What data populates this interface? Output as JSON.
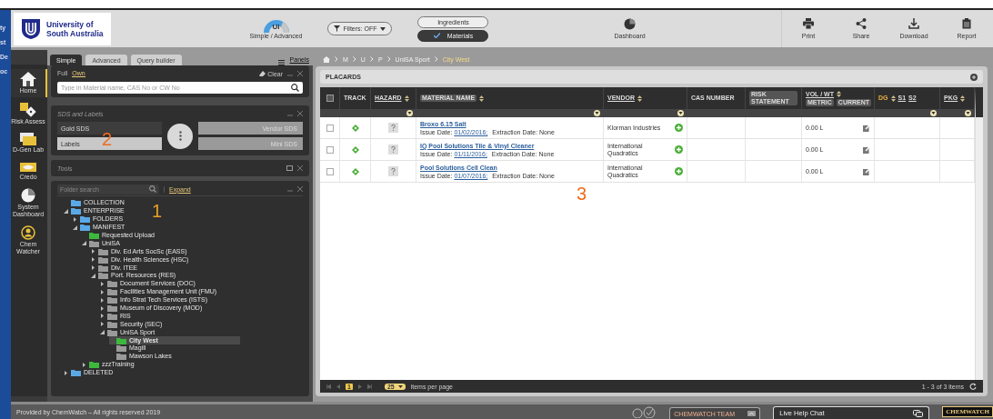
{
  "backdrop_fragments": [
    "ty",
    "st",
    "De",
    "oc"
  ],
  "header": {
    "logo_text": [
      "University of",
      "South Australia"
    ],
    "ui_toggle": {
      "label": "UI",
      "caption": "Simple / Advanced"
    },
    "filters": {
      "label": "Filters: OFF"
    },
    "mode_toggles": [
      {
        "label": "Ingredients",
        "selected": false
      },
      {
        "label": "Materials",
        "selected": true
      }
    ],
    "dashboard": "Dashboard",
    "actions": [
      {
        "kind": "print",
        "label": "Print"
      },
      {
        "kind": "share",
        "label": "Share"
      },
      {
        "kind": "download",
        "label": "Download"
      },
      {
        "kind": "report",
        "label": "Report"
      }
    ]
  },
  "sidebar": [
    {
      "kind": "home",
      "label": "Home",
      "selected": true
    },
    {
      "kind": "risk",
      "label": "Risk Assess",
      "selected": false
    },
    {
      "kind": "dgen",
      "label": "D-Gen Lab",
      "selected": false
    },
    {
      "kind": "credo",
      "label": "Credo",
      "selected": false
    },
    {
      "kind": "dashboard",
      "label": "System Dashboard",
      "selected": false
    },
    {
      "kind": "watcher",
      "label": "Chem Watcher",
      "selected": false
    }
  ],
  "left_tabs": [
    {
      "label": "Simple",
      "selected": true
    },
    {
      "label": "Advanced",
      "selected": false
    },
    {
      "label": "Query builder",
      "selected": false
    }
  ],
  "panels_link": "Panels",
  "search_panel": {
    "scopes": [
      {
        "label": "Full",
        "selected": false
      },
      {
        "label": "Own",
        "selected": true
      }
    ],
    "clear": "Clear",
    "placeholder": "Type in Material name, CAS No or CW No"
  },
  "sds_panel": {
    "title": "SDS and Labels",
    "options": [
      {
        "label": "Gold SDS",
        "selected": false
      },
      {
        "label": "Vendor SDS",
        "selected": false
      },
      {
        "label": "Labels",
        "selected": true
      },
      {
        "label": "Mini SDS",
        "selected": false
      }
    ]
  },
  "tools_panel": {
    "title": "Tools"
  },
  "folder_panel": {
    "placeholder": "Folder search",
    "expand": "Expand",
    "tree": [
      {
        "label": "COLLECTION",
        "color": "#5aa9e6",
        "selected": false
      },
      {
        "label": "ENTERPRISE",
        "color": "#5aa9e6",
        "expanded": true,
        "selected": false,
        "children": [
          {
            "label": "FOLDERS",
            "color": "#5aa9e6",
            "expanded": false,
            "selected": false
          },
          {
            "label": "MANIFEST",
            "color": "#5aa9e6",
            "expanded": true,
            "selected": false,
            "children": [
              {
                "label": "Requested Upload",
                "color": "#3db83d",
                "selected": false
              },
              {
                "label": "UniSA",
                "color": "#9a9a9a",
                "expanded": true,
                "selected": false,
                "children": [
                  {
                    "label": "Div. Ed Arts SocSc (EASS)",
                    "color": "#9a9a9a",
                    "expanded": false,
                    "selected": false
                  },
                  {
                    "label": "Div. Health Sciences (HSC)",
                    "color": "#9a9a9a",
                    "expanded": false,
                    "selected": false
                  },
                  {
                    "label": "Div. ITEE",
                    "color": "#9a9a9a",
                    "expanded": false,
                    "selected": false
                  },
                  {
                    "label": "Port. Resources (RES)",
                    "color": "#9a9a9a",
                    "expanded": true,
                    "selected": false,
                    "children": [
                      {
                        "label": "Document Services (DOC)",
                        "color": "#9a9a9a",
                        "expanded": false,
                        "selected": false
                      },
                      {
                        "label": "Facilities Management Unit (FMU)",
                        "color": "#9a9a9a",
                        "expanded": false,
                        "selected": false
                      },
                      {
                        "label": "Info Strat Tech Services (ISTS)",
                        "color": "#9a9a9a",
                        "expanded": false,
                        "selected": false
                      },
                      {
                        "label": "Museum of Discovery (MOD)",
                        "color": "#9a9a9a",
                        "expanded": false,
                        "selected": false
                      },
                      {
                        "label": "RIS",
                        "color": "#9a9a9a",
                        "expanded": false,
                        "selected": false
                      },
                      {
                        "label": "Security (SEC)",
                        "color": "#9a9a9a",
                        "expanded": false,
                        "selected": false
                      },
                      {
                        "label": "UniSA Sport",
                        "color": "#9a9a9a",
                        "expanded": true,
                        "selected": false,
                        "children": [
                          {
                            "label": "City West",
                            "color": "#3db83d",
                            "selected": true
                          },
                          {
                            "label": "Magill",
                            "color": "#9a9a9a",
                            "selected": false
                          },
                          {
                            "label": "Mawson Lakes",
                            "color": "#9a9a9a",
                            "selected": false
                          }
                        ]
                      }
                    ]
                  }
                ]
              },
              {
                "label": "zzzTraining",
                "color": "#3db83d",
                "expanded": false,
                "selected": false
              }
            ]
          }
        ]
      },
      {
        "label": "DELETED",
        "color": "#5aa9e6",
        "expanded": false,
        "selected": false
      }
    ]
  },
  "breadcrumb": [
    {
      "label": "M",
      "current": false
    },
    {
      "label": "U",
      "current": false
    },
    {
      "label": "P",
      "current": false
    },
    {
      "label": "UniSA Sport",
      "current": false
    },
    {
      "label": "City West",
      "current": true
    }
  ],
  "placards": {
    "title": "PLACARDS",
    "all_selected": false,
    "columns": [
      {
        "kind": "checkbox"
      },
      {
        "kind": "plain",
        "label": "TRACK"
      },
      {
        "kind": "link",
        "label": "HAZARD",
        "sortable": true,
        "filter": true
      },
      {
        "kind": "pill",
        "label": "MATERIAL NAME",
        "sortable": true,
        "filter": true
      },
      {
        "kind": "link",
        "label": "VENDOR",
        "sortable": true,
        "filter": true
      },
      {
        "kind": "plain",
        "label": "CAS NUMBER"
      },
      {
        "kind": "pill",
        "label": "RISK STATEMENT"
      },
      {
        "kind": "link",
        "label": "VOL / WT",
        "sortable": true,
        "tags": [
          "METRIC",
          "CURRENT"
        ]
      },
      {
        "kind": "accent",
        "label": "DG",
        "sortable": true,
        "filter": true,
        "links": [
          "S1",
          "S2"
        ]
      },
      {
        "kind": "link",
        "label": "PKG",
        "sortable": true,
        "filter": true
      }
    ],
    "rows": [
      {
        "selected": false,
        "name": "Broxo 6.15 Salt",
        "issue_label": "Issue Date:",
        "issue_date": "01/02/2016;",
        "extraction": "Extraction Date: None",
        "vendor": "Klorman Industries",
        "volume": "0.00 L"
      },
      {
        "selected": false,
        "name": "IQ Pool Solutions Tile & Vinyl Cleaner",
        "issue_label": "Issue Date:",
        "issue_date": "01/11/2016;",
        "extraction": "Extraction Date: None",
        "vendor": "International Quadratics",
        "volume": "0.00 L"
      },
      {
        "selected": false,
        "name": "Pool Solutions Cell Clean",
        "issue_label": "Issue Date:",
        "issue_date": "01/07/2016;",
        "extraction": "Extraction Date: None",
        "vendor": "International Quadratics",
        "volume": "0.00 L"
      }
    ],
    "pager": {
      "page": "1",
      "page_size": "25",
      "page_size_label": "items per page",
      "summary": "1 - 3 of 3 items"
    }
  },
  "annotations": {
    "tree": "1",
    "sds": "2",
    "table": "3"
  },
  "footer": {
    "copyright": "Provided by ChemWatch – All rights reserved 2019",
    "team": "CHEMWATCH TEAM",
    "chat": "Live Help Chat",
    "brand": "CHEMWATCH"
  }
}
